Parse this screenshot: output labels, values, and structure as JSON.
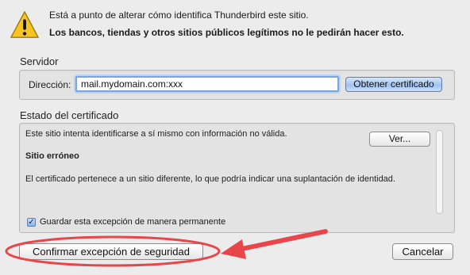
{
  "header": {
    "icon": "warning-triangle-icon",
    "message": "Está a punto de alterar cómo identifica Thunderbird este sitio.",
    "warning": "Los bancos, tiendas y otros sitios públicos legítimos no le pedirán hacer esto."
  },
  "server": {
    "title": "Servidor",
    "address_label": "Dirección:",
    "address_value": "mail.mydomain.com:xxx",
    "get_certificate_label": "Obtener certificado"
  },
  "certificate_status": {
    "title": "Estado del certificado",
    "intro": "Este sitio intenta identificarse a sí mismo con información no válida.",
    "view_label": "Ver...",
    "problem_heading": "Sitio erróneo",
    "problem_detail": "El certificado pertenece a un sitio diferente, lo que podría indicar una suplantación de identidad.",
    "permanent_checkbox_label": "Guardar esta excepción de manera permanente",
    "permanent_checked": true
  },
  "actions": {
    "confirm_label": "Confirmar excepción de seguridad",
    "cancel_label": "Cancelar"
  },
  "colors": {
    "annotation": "#e8464b",
    "warning_fill": "#f6c523"
  }
}
